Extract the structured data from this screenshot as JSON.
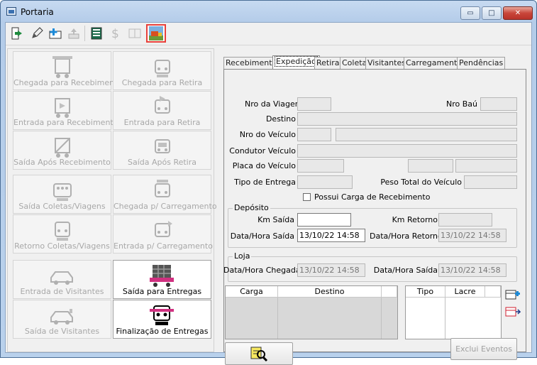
{
  "window": {
    "title": "Portaria",
    "min_label": "▭",
    "max_label": "□",
    "close_label": "✕"
  },
  "toolbar": {
    "icons": [
      "exit-door-icon",
      "pencil-icon",
      "add-folder-icon",
      "export-icon",
      "spreadsheet-icon",
      "dollar-icon",
      "book-icon",
      "truck-scene-icon"
    ]
  },
  "left_buttons": [
    {
      "label": "Chegada para Recebimento",
      "enabled": false
    },
    {
      "label": "Chegada para Retira",
      "enabled": false
    },
    {
      "label": "Entrada para Recebimento",
      "enabled": false
    },
    {
      "label": "Entrada para Retira",
      "enabled": false
    },
    {
      "label": "Saída Após Recebimento",
      "enabled": false
    },
    {
      "label": "Saída Após Retira",
      "enabled": false
    },
    {
      "label": "Saída Coletas/Viagens",
      "enabled": false
    },
    {
      "label": "Chegada p/ Carregamento",
      "enabled": false
    },
    {
      "label": "Retorno Coletas/Viagens",
      "enabled": false
    },
    {
      "label": "Entrada p/ Carregamento",
      "enabled": false
    },
    {
      "label": "Entrada de Visitantes",
      "enabled": false
    },
    {
      "label": "Saída para Entregas",
      "enabled": true
    },
    {
      "label": "Saída de Visitantes",
      "enabled": false
    },
    {
      "label": "Finalização de Entregas",
      "enabled": true
    }
  ],
  "tabs": [
    "Recebimento",
    "Expedição",
    "Retira",
    "Coleta",
    "Visitantes",
    "Carregamento",
    "Pendências"
  ],
  "active_tab": "Expedição",
  "form": {
    "nro_viagem": "Nro da Viagem",
    "nro_bau": "Nro Baú",
    "destino": "Destino",
    "nro_veiculo": "Nro do Veículo",
    "condutor": "Condutor Veículo",
    "placa": "Placa do Veículo",
    "tipo_entrega": "Tipo de Entrega",
    "peso_total": "Peso Total do Veículo",
    "possui_carga": "Possui Carga de Recebimento"
  },
  "deposito": {
    "title": "Depósito",
    "km_saida": "Km Saída",
    "km_retorno": "Km Retorno",
    "dh_saida": "Data/Hora Saída",
    "dh_saida_value": "13/10/22  14:58",
    "dh_retorno": "Data/Hora Retorno",
    "dh_retorno_value": "13/10/22  14:58"
  },
  "loja": {
    "title": "Loja",
    "dh_chegada": "Data/Hora Chegada",
    "dh_chegada_value": "13/10/22  14:58",
    "dh_saida": "Data/Hora Saída",
    "dh_saida_value": "13/10/22  14:58"
  },
  "grid1": {
    "headers": [
      "Carga",
      "Destino"
    ]
  },
  "grid2": {
    "headers": [
      "Tipo",
      "Lacre"
    ]
  },
  "excluir_eventos": "Exclui Eventos"
}
